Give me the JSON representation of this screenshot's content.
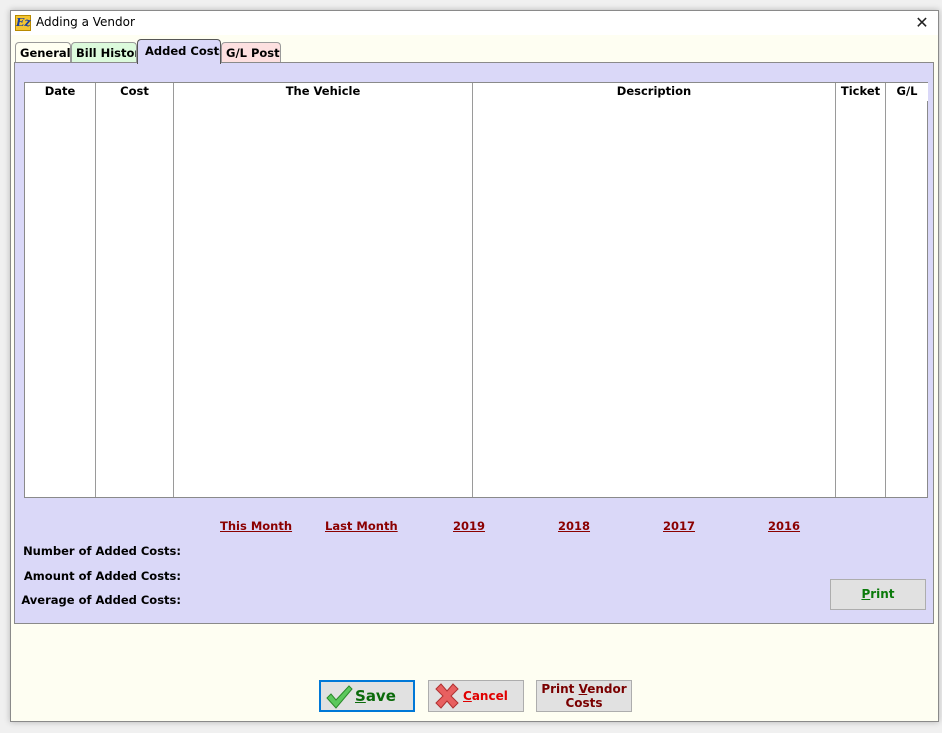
{
  "window": {
    "title": "Adding a Vendor",
    "app_icon": "ez-app-icon",
    "close_icon": "close-icon"
  },
  "tabs": [
    {
      "label": "General",
      "active": false
    },
    {
      "label": "Bill History",
      "active": false
    },
    {
      "label": "Added Costs",
      "active": true
    },
    {
      "label": "G/L Posts",
      "active": false
    }
  ],
  "grid": {
    "columns": [
      "Date",
      "Cost",
      "The Vehicle",
      "Description",
      "Ticket",
      "G/L"
    ],
    "rows": []
  },
  "periods": [
    "This Month",
    "Last Month",
    "2019",
    "2018",
    "2017",
    "2016"
  ],
  "stats": {
    "number_label": "Number of Added Costs:",
    "amount_label": "Amount of Added Costs:",
    "average_label": "Average of Added Costs:"
  },
  "buttons": {
    "print": {
      "accel": "P",
      "rest": "rint"
    },
    "save": {
      "accel": "S",
      "rest": "ave"
    },
    "cancel": {
      "accel": "C",
      "rest": "ancel"
    },
    "print_vendor_costs": {
      "line1_pre": "Print ",
      "accel": "V",
      "line1_post": "endor",
      "line2": "Costs"
    }
  },
  "colors": {
    "panel_bg": "#dad8f8",
    "window_bg": "#fefef2",
    "link_color": "#8b0000",
    "focus_border": "#0078d7"
  }
}
